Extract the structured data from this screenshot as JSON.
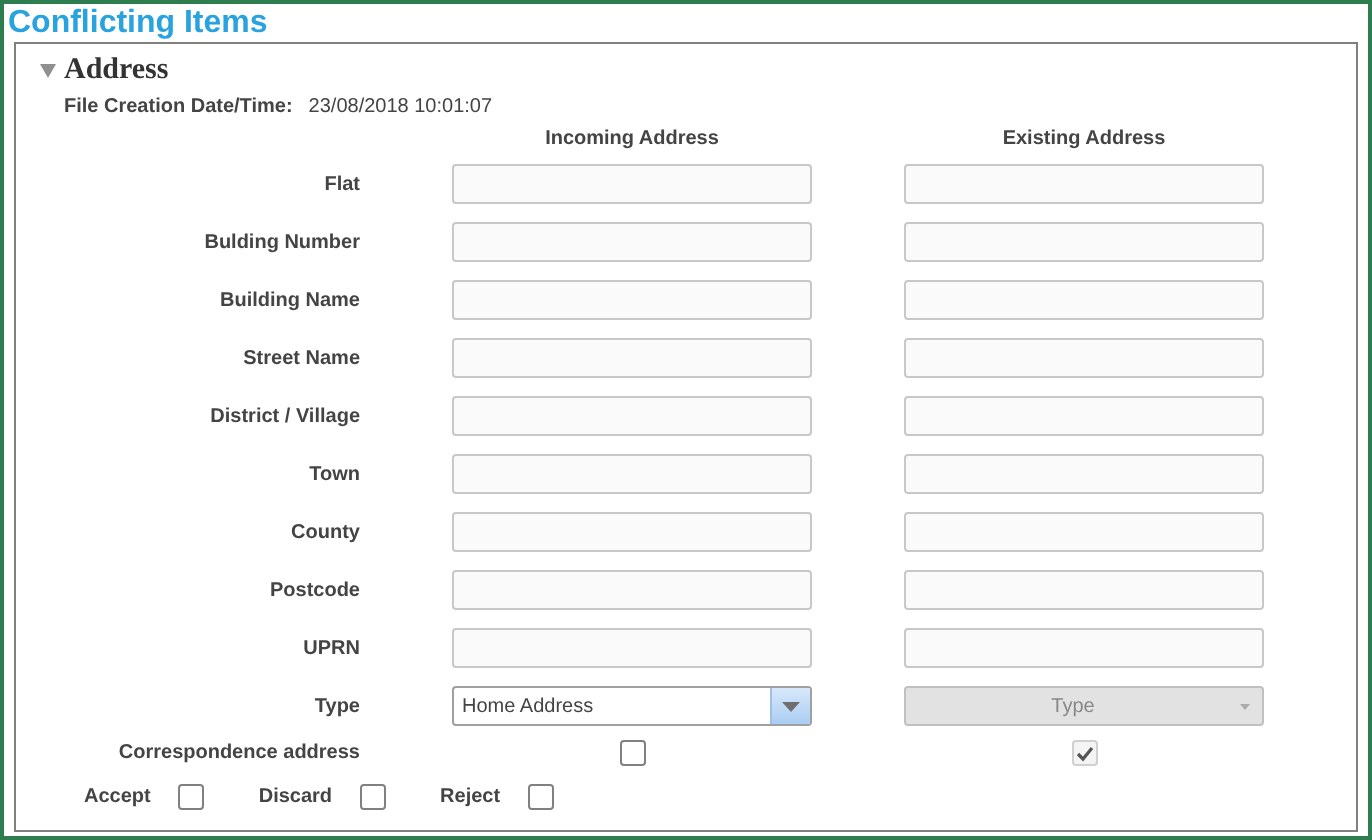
{
  "title": "Conflicting Items",
  "section": {
    "title": "Address",
    "expanded": true
  },
  "file_creation": {
    "label": "File Creation Date/Time:",
    "value": "23/08/2018 10:01:07"
  },
  "columns": [
    "Incoming Address",
    "Existing Address"
  ],
  "fields": [
    {
      "label": "Flat"
    },
    {
      "label": "Bulding Number"
    },
    {
      "label": "Building Name"
    },
    {
      "label": "Street Name"
    },
    {
      "label": "District / Village"
    },
    {
      "label": "Town"
    },
    {
      "label": "County"
    },
    {
      "label": "Postcode"
    },
    {
      "label": "UPRN"
    }
  ],
  "type_row": {
    "label": "Type",
    "incoming": {
      "value": "Home Address",
      "disabled": false
    },
    "existing": {
      "placeholder": "Type",
      "disabled": true
    }
  },
  "correspondence": {
    "label": "Correspondence address",
    "incoming": {
      "checked": false,
      "disabled": false
    },
    "existing": {
      "checked": true,
      "disabled": true
    }
  },
  "actions": [
    {
      "label": "Accept",
      "checked": false
    },
    {
      "label": "Discard",
      "checked": false
    },
    {
      "label": "Reject",
      "checked": false
    }
  ]
}
